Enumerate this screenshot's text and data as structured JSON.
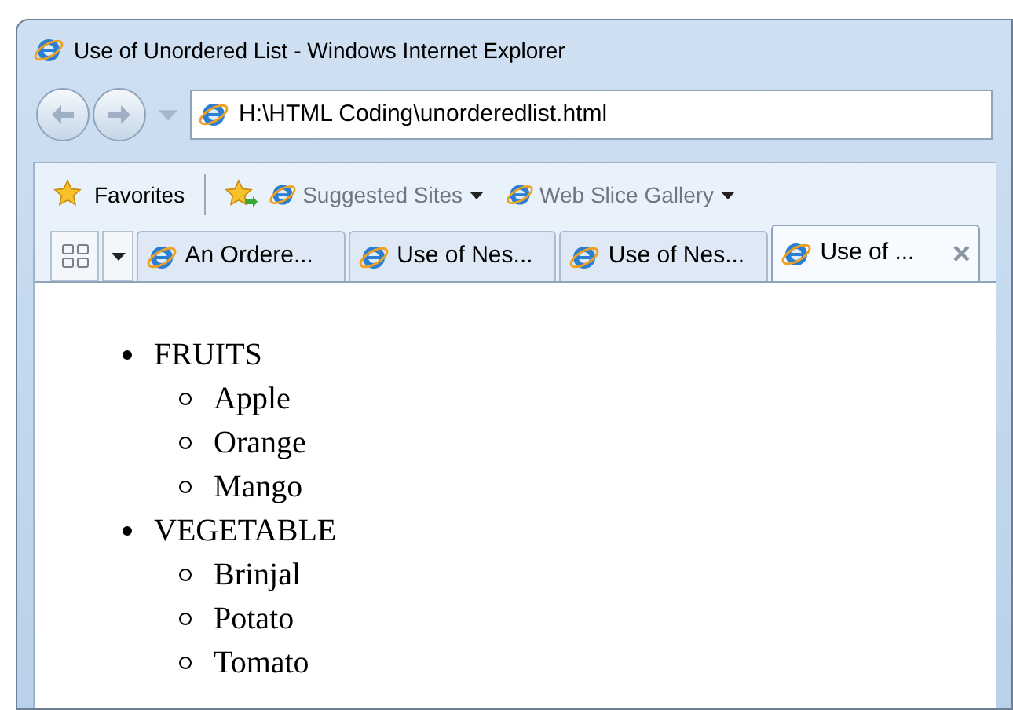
{
  "window": {
    "title": "Use of Unordered List - Windows Internet Explorer"
  },
  "address_bar": {
    "value": "H:\\HTML Coding\\unorderedlist.html"
  },
  "favorites_bar": {
    "favorites": "Favorites",
    "links": [
      {
        "label": "Suggested Sites"
      },
      {
        "label": "Web Slice Gallery"
      }
    ]
  },
  "tabs": [
    {
      "label": "An Ordere...",
      "selected": false
    },
    {
      "label": "Use of Nes...",
      "selected": false
    },
    {
      "label": "Use of Nes...",
      "selected": false
    },
    {
      "label": "Use of ...",
      "selected": true
    }
  ],
  "close_tab": "×",
  "list": [
    {
      "label": "FRUITS",
      "children": [
        {
          "label": "Apple"
        },
        {
          "label": "Orange"
        },
        {
          "label": "Mango"
        }
      ]
    },
    {
      "label": "VEGETABLE",
      "children": [
        {
          "label": "Brinjal"
        },
        {
          "label": "Potato"
        },
        {
          "label": "Tomato"
        }
      ]
    }
  ]
}
